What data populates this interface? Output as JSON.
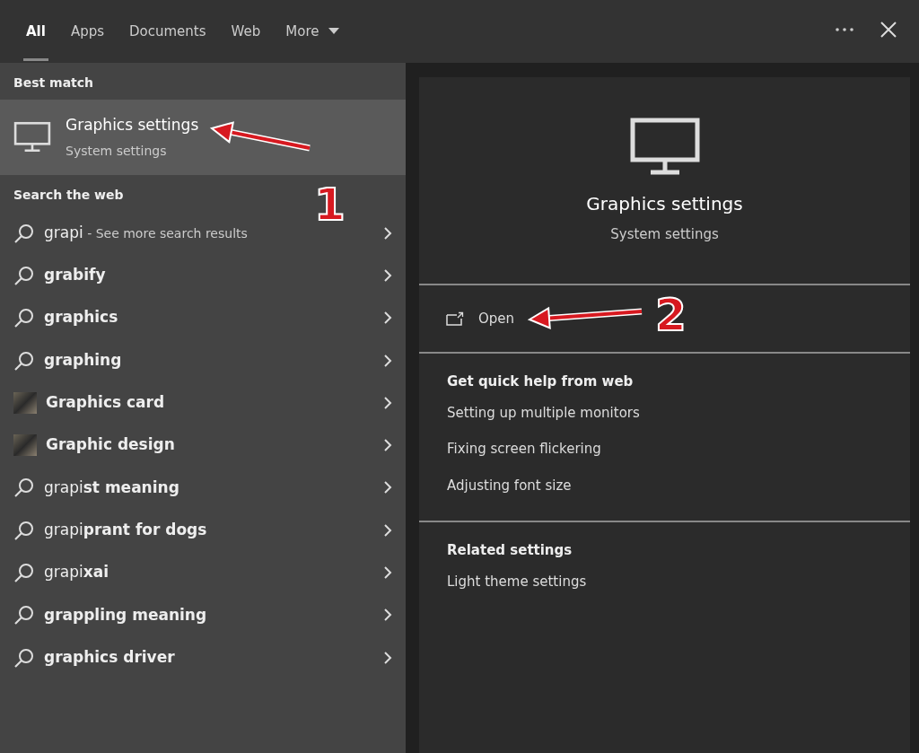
{
  "tabs": [
    {
      "label": "All",
      "selected": true
    },
    {
      "label": "Apps",
      "selected": false
    },
    {
      "label": "Documents",
      "selected": false
    },
    {
      "label": "Web",
      "selected": false
    },
    {
      "label": "More",
      "selected": false,
      "dropdown": true
    }
  ],
  "best_match": {
    "heading": "Best match",
    "title": "Graphics settings",
    "subtitle": "System settings",
    "selected": true
  },
  "web": {
    "heading": "Search the web",
    "items": [
      {
        "kind": "search",
        "text": "grapi",
        "hint": " - See more search results"
      },
      {
        "kind": "search",
        "text": "**grabify**"
      },
      {
        "kind": "search",
        "text": "**graphics**"
      },
      {
        "kind": "search",
        "text": "**graphing**"
      },
      {
        "kind": "image",
        "text": "**Graphics card**"
      },
      {
        "kind": "image",
        "text": "**Graphic design**"
      },
      {
        "kind": "search",
        "text": "grapi**st meaning**"
      },
      {
        "kind": "search",
        "text": "grapi**prant for dogs**"
      },
      {
        "kind": "search",
        "text": "grapi**xai**"
      },
      {
        "kind": "search",
        "text": "**grappling meaning**"
      },
      {
        "kind": "search",
        "text": "**graphics driver**"
      }
    ]
  },
  "preview": {
    "title": "Graphics settings",
    "subtitle": "System settings",
    "open": "Open",
    "help": {
      "heading": "Get quick help from web",
      "links": [
        "Setting up multiple monitors",
        "Fixing screen flickering",
        "Adjusting font size"
      ]
    },
    "related": {
      "heading": "Related settings",
      "links": [
        "Light theme settings"
      ]
    }
  },
  "annotations": [
    {
      "label": "1"
    },
    {
      "label": "2"
    }
  ]
}
